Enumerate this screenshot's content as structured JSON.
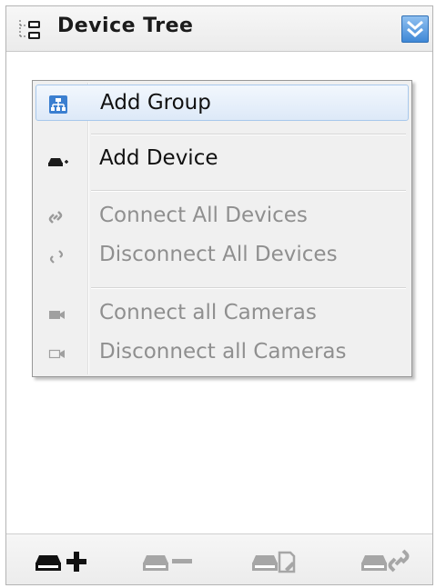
{
  "panel": {
    "title": "Device Tree",
    "header_icon": "device-tree-icon",
    "collapse_icon": "double-chevron-down-icon"
  },
  "context_menu": {
    "items": [
      {
        "label": "Add Group",
        "icon": "group-icon",
        "enabled": true
      },
      {
        "label": "Add Device",
        "icon": "add-device-icon",
        "enabled": true
      },
      {
        "label": "Connect All Devices",
        "icon": "link-icon",
        "enabled": false
      },
      {
        "label": "Disconnect All Devices",
        "icon": "broken-link-icon",
        "enabled": false
      },
      {
        "label": "Connect all Cameras",
        "icon": "camera-icon",
        "enabled": false
      },
      {
        "label": "Disconnect all Cameras",
        "icon": "camera-outline-icon",
        "enabled": false
      }
    ]
  },
  "toolbar": {
    "buttons": [
      {
        "icon": "add-device-icon",
        "enabled": true
      },
      {
        "icon": "remove-device-icon",
        "enabled": false
      },
      {
        "icon": "edit-device-icon",
        "enabled": false
      },
      {
        "icon": "connect-device-icon",
        "enabled": false
      }
    ]
  },
  "colors": {
    "highlight": "#dde9f8",
    "disabled_text": "#8f8f8f",
    "accent_blue": "#3f88d6"
  }
}
